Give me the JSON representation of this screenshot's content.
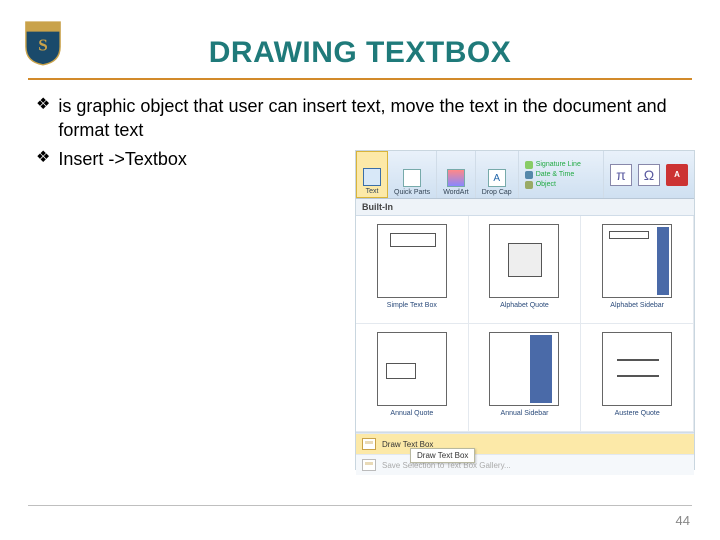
{
  "logo": {
    "letter": "S"
  },
  "title": "DRAWING TEXTBOX",
  "bullets": [
    "is graphic object that user can insert text, move the text in the document and format text",
    "Insert ->Textbox"
  ],
  "panel": {
    "ribbon": {
      "text_button": "Text",
      "quick_parts": "Quick Parts",
      "wordart": "WordArt",
      "dropcap": "Drop Cap",
      "signature": "Signature Line",
      "datetime": "Date & Time",
      "object": "Object",
      "equation": "Equation",
      "symbol": "Symbol",
      "pdf": "PDF"
    },
    "gallery_header": "Built-In",
    "gallery": [
      "Simple Text Box",
      "Alphabet Quote",
      "Alphabet Sidebar",
      "Annual Quote",
      "Annual Sidebar",
      "Austere Quote"
    ],
    "actions": {
      "draw": "Draw Text Box",
      "save": "Save Selection to Text Box Gallery..."
    },
    "tooltip": "Draw Text Box"
  },
  "page_number": "44"
}
